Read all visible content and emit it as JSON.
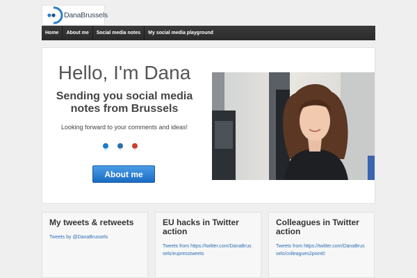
{
  "site": {
    "logo_text": "DanaBrussels"
  },
  "nav": {
    "items": [
      {
        "label": "Home"
      },
      {
        "label": "About me"
      },
      {
        "label": "Social media notes"
      },
      {
        "label": "My social media playground"
      }
    ]
  },
  "hero": {
    "title": "Hello, I'm Dana",
    "subtitle": "Sending you social media notes from Brussels",
    "text": "Looking forward to your comments and ideas!",
    "social_icons": [
      "twitter-icon",
      "linkedin-icon",
      "google-plus-icon"
    ],
    "button_label": "About me"
  },
  "cards": [
    {
      "title": "My tweets & retweets",
      "link": "Tweets by @DanaBrussels"
    },
    {
      "title": "EU hacks in Twitter action",
      "link": "Tweets from https://twitter.com/DanaBrussels/eupresstweets"
    },
    {
      "title": "Colleagues in Twitter action",
      "link": "Tweets from https://twitter.com/DanaBrussels/colleagues2point0"
    }
  ],
  "colors": {
    "nav_bg": "#333333",
    "button_blue": "#2e86d8",
    "link_blue": "#2a6fb5",
    "page_bg": "#efefef"
  }
}
